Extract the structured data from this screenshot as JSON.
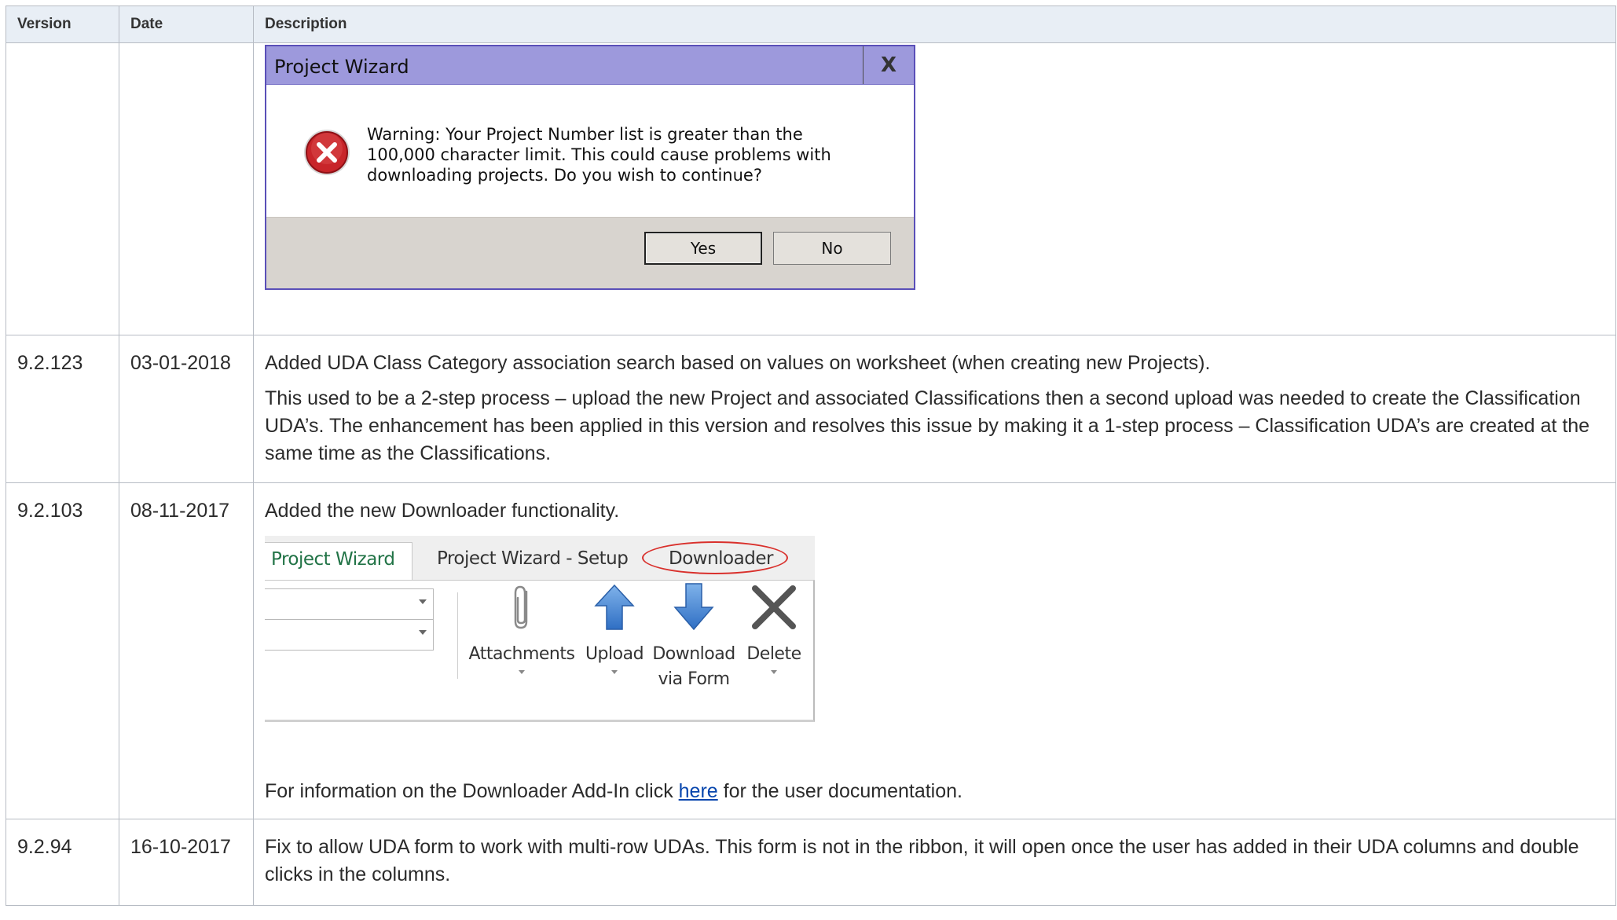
{
  "table": {
    "headers": {
      "version": "Version",
      "date": "Date",
      "description": "Description"
    },
    "rows": [
      {
        "version": "",
        "date": "",
        "dialog": {
          "title": "Project Wizard",
          "close_glyph": "X",
          "icon": "error-icon",
          "message": "Warning: Your Project Number list is greater than the 100,000 character limit. This could cause problems with downloading projects. Do you wish to continue?",
          "yes_label": "Yes",
          "no_label": "No"
        }
      },
      {
        "version": "9.2.123",
        "date": "03-01-2018",
        "para1": "Added UDA Class Category association search based on values on worksheet (when creating new Projects).",
        "para2": "This used to be a 2-step process – upload the new Project and associated Classifications then a second upload was needed to create the Classification UDA’s.  The enhancement has been applied in this version and resolves this issue by making it a 1-step process – Classification UDA’s are created at the same time as the Classifications."
      },
      {
        "version": "9.2.103",
        "date": "08-11-2017",
        "para1": "Added the new Downloader functionality.",
        "ribbon": {
          "tabs": [
            "Project Wizard",
            "Project Wizard - Setup",
            "Downloader"
          ],
          "buttons": [
            {
              "label": "Attachments",
              "icon": "paperclip-icon"
            },
            {
              "label": "Upload",
              "icon": "up-arrow-icon"
            },
            {
              "label": "Download via Form",
              "line1": "Download",
              "line2": "via Form",
              "icon": "down-arrow-icon"
            },
            {
              "label": "Delete",
              "icon": "delete-x-icon"
            }
          ]
        },
        "info_prefix": "For information on the Downloader Add-In click ",
        "info_link": "here",
        "info_suffix": " for the user documentation."
      },
      {
        "version": "9.2.94",
        "date": "16-10-2017",
        "para1": "Fix to allow UDA form to work with multi-row UDAs.  This form is not in the ribbon, it will open once the user has added in their UDA columns and double clicks in the columns."
      }
    ]
  },
  "colors": {
    "header_bg": "#e8eef5",
    "dialog_title_bg": "#9d99dc",
    "link": "#0645ad",
    "downloader_highlight": "#d9302c",
    "ribbon_active_tab": "#217346"
  }
}
